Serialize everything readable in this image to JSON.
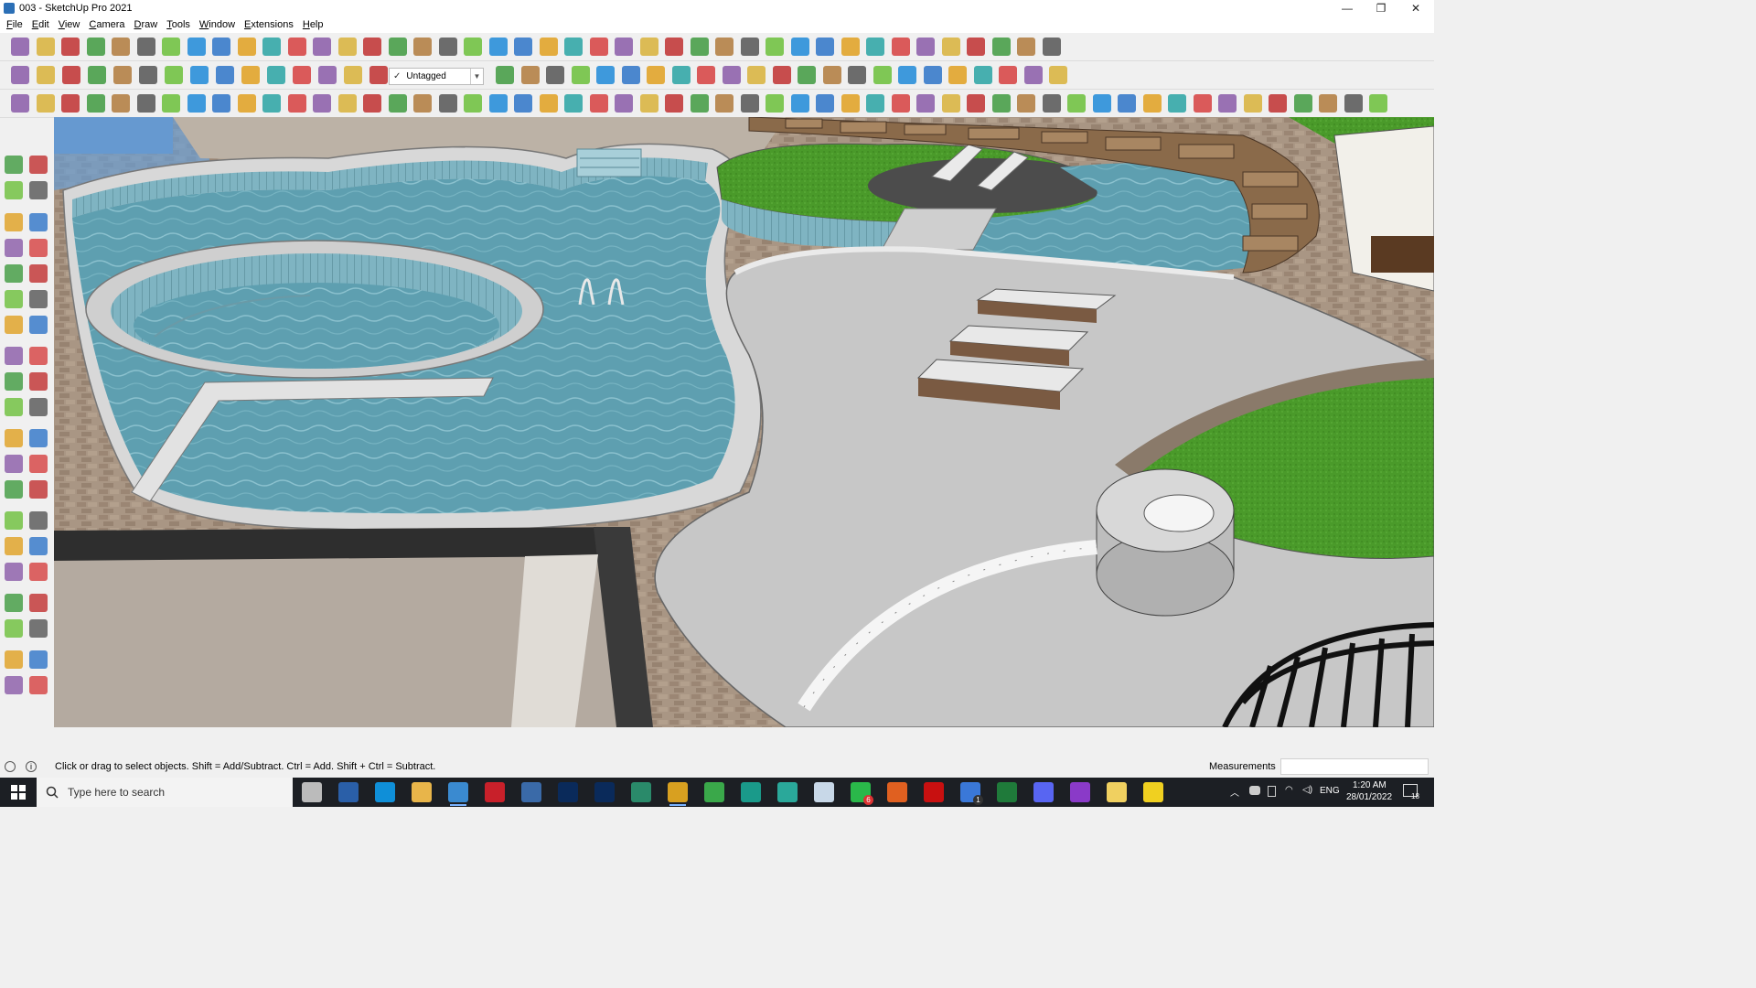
{
  "window": {
    "title": "003 - SketchUp Pro 2021",
    "minimize_glyph": "—",
    "maximize_glyph": "❐",
    "close_glyph": "✕"
  },
  "menu": [
    "File",
    "Edit",
    "View",
    "Camera",
    "Draw",
    "Tools",
    "Window",
    "Extensions",
    "Help"
  ],
  "toolbar": {
    "tag_selected": "Untagged",
    "tag_check": "✓",
    "tag_dropdown": "▼"
  },
  "status": {
    "hint": "Click or drag to select objects. Shift = Add/Subtract. Ctrl = Add. Shift + Ctrl = Subtract.",
    "measurements_label": "Measurements",
    "measurements_value": ""
  },
  "taskbar": {
    "search_placeholder": "Type here to search",
    "language": "ENG",
    "time": "1:20 AM",
    "date": "28/01/2022",
    "notification_count": "18",
    "whatsapp_badge": "6",
    "task_badge": "1",
    "apps": [
      "task-view",
      "calculator",
      "edge",
      "file-explorer",
      "sketchup",
      "acrobat",
      "unknown-tool",
      "photoshop",
      "photoshop-2",
      "terminal",
      "chrome",
      "chrome-2",
      "sketchup-layout",
      "3d-app",
      "notes",
      "whatsapp",
      "grammarly",
      "opera",
      "todo",
      "excel",
      "discord",
      "podcast",
      "folder",
      "sticky-notes"
    ]
  },
  "colors": {
    "water": "#5f9fb0",
    "deck": "#c9c9c9",
    "grass": "#4a9a2a",
    "stone": "#8a6a4a",
    "pergola": "#3a3a3a"
  }
}
